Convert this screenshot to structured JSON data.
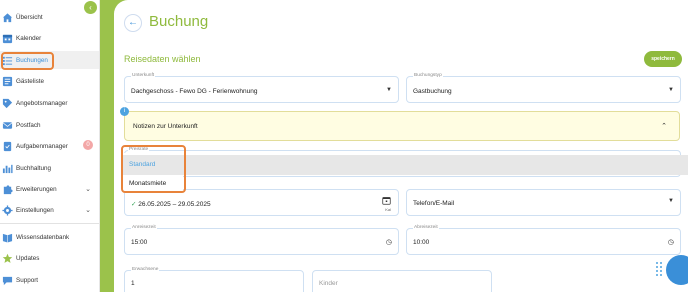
{
  "sidebar": {
    "collapse_glyph": "‹",
    "items": [
      {
        "label": "Übersicht",
        "icon": "home-icon"
      },
      {
        "label": "Kalender",
        "icon": "calendar-icon"
      },
      {
        "label": "Buchungen",
        "icon": "list-icon"
      },
      {
        "label": "Gästeliste",
        "icon": "guestlist-icon"
      },
      {
        "label": "Angebotsmanager",
        "icon": "offer-icon"
      },
      {
        "label": "Postfach",
        "icon": "mail-icon"
      },
      {
        "label": "Aufgabenmanager",
        "icon": "tasks-icon",
        "badge": "0"
      },
      {
        "label": "Buchhaltung",
        "icon": "accounting-icon"
      },
      {
        "label": "Erweiterungen",
        "icon": "puzzle-icon"
      },
      {
        "label": "Einstellungen",
        "icon": "gear-icon"
      },
      {
        "label": "Wissensdatenbank",
        "icon": "knowledge-icon"
      },
      {
        "label": "Updates",
        "icon": "star-icon"
      },
      {
        "label": "Support",
        "icon": "support-icon"
      }
    ],
    "chevron": "⌄"
  },
  "header": {
    "back_glyph": "←",
    "title": "Buchung"
  },
  "form": {
    "section_title": "Reisedaten wählen",
    "save_label": "speichern",
    "unterkunft": {
      "label": "Unterkunft",
      "value": "Dachgeschoss - Fewo DG - Ferienwohnung"
    },
    "buchungstyp": {
      "label": "Buchungstyp",
      "value": "Gastbuchung"
    },
    "notes": {
      "label": "Notizen zur Unterkunft",
      "info": "i"
    },
    "preisrate": {
      "label": "Preisrate",
      "options": [
        "Standard",
        "Monatsmiete"
      ]
    },
    "dates": {
      "check": "✓",
      "value": "26.05.2025 – 29.05.2025",
      "cal_hint": "Kal"
    },
    "channel": {
      "value": "Telefon/E-Mail"
    },
    "anreise": {
      "label": "Anreisezeit",
      "value": "15:00"
    },
    "abreise": {
      "label": "Abreisezeit",
      "value": "10:00"
    },
    "erwachsene": {
      "label": "Erwachsene",
      "value": "1"
    },
    "kinder": {
      "placeholder": "Kinder"
    }
  },
  "colors": {
    "accent": "#8fba3d",
    "link": "#3a8fd8",
    "highlight": "#e8833a",
    "background": "#9bc24b"
  }
}
